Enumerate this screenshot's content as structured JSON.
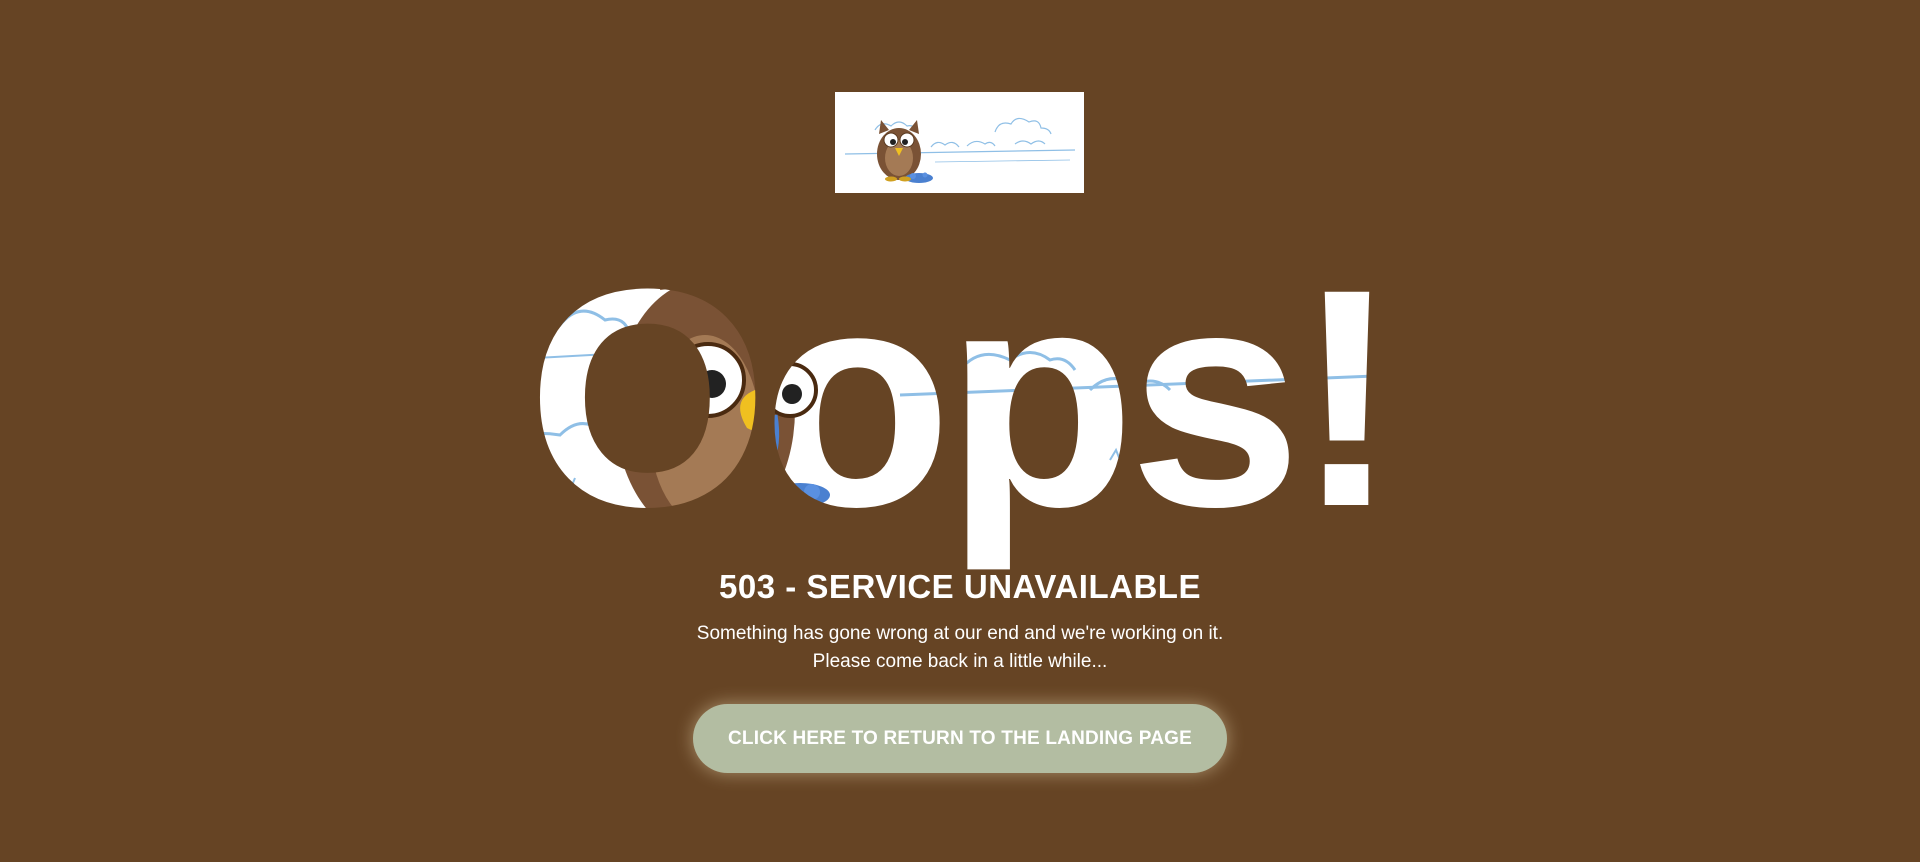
{
  "hero": {
    "headline": "Oops!"
  },
  "error": {
    "title": "503 - SERVICE UNAVAILABLE",
    "message_line_1": "Something has gone wrong at our end and we're working on it.",
    "message_line_2": "Please come back in a little while..."
  },
  "actions": {
    "return_label": "CLICK HERE TO RETURN TO THE LANDING PAGE"
  },
  "colors": {
    "background": "#664424",
    "button": "#b3bda2",
    "text": "#ffffff",
    "owl_brown": "#7a5235",
    "sky_line": "#8fbfe6"
  },
  "illustration": "owl-drinking-from-puddle"
}
